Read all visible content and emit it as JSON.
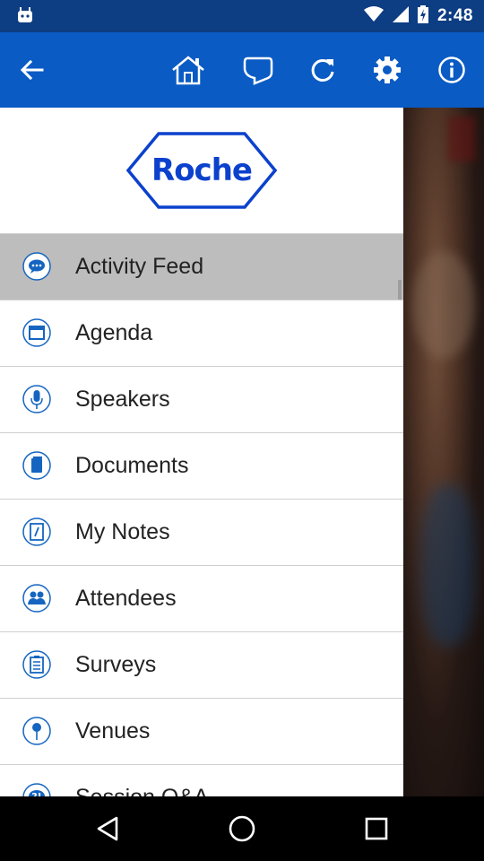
{
  "status_bar": {
    "time": "2:48"
  },
  "app_bar": {
    "icons": [
      "back-arrow-icon",
      "home-icon",
      "chat-bubble-icon",
      "refresh-icon",
      "settings-icon",
      "info-icon"
    ]
  },
  "drawer": {
    "logo_text": "Roche",
    "items": [
      {
        "label": "Activity Feed",
        "icon": "chat-bubble-icon",
        "active": true
      },
      {
        "label": "Agenda",
        "icon": "calendar-icon",
        "active": false
      },
      {
        "label": "Speakers",
        "icon": "microphone-icon",
        "active": false
      },
      {
        "label": "Documents",
        "icon": "document-icon",
        "active": false
      },
      {
        "label": "My Notes",
        "icon": "notes-icon",
        "active": false
      },
      {
        "label": "Attendees",
        "icon": "people-icon",
        "active": false
      },
      {
        "label": "Surveys",
        "icon": "clipboard-icon",
        "active": false
      },
      {
        "label": "Venues",
        "icon": "map-pin-icon",
        "active": false
      },
      {
        "label": "Session Q&A",
        "icon": "question-icon",
        "active": false
      }
    ]
  },
  "colors": {
    "status_bar": "#0d3d82",
    "app_bar": "#0a5bc4",
    "brand_blue": "#0b41cd",
    "icon_blue": "#1565c0",
    "active_row": "#bdbdbd"
  }
}
